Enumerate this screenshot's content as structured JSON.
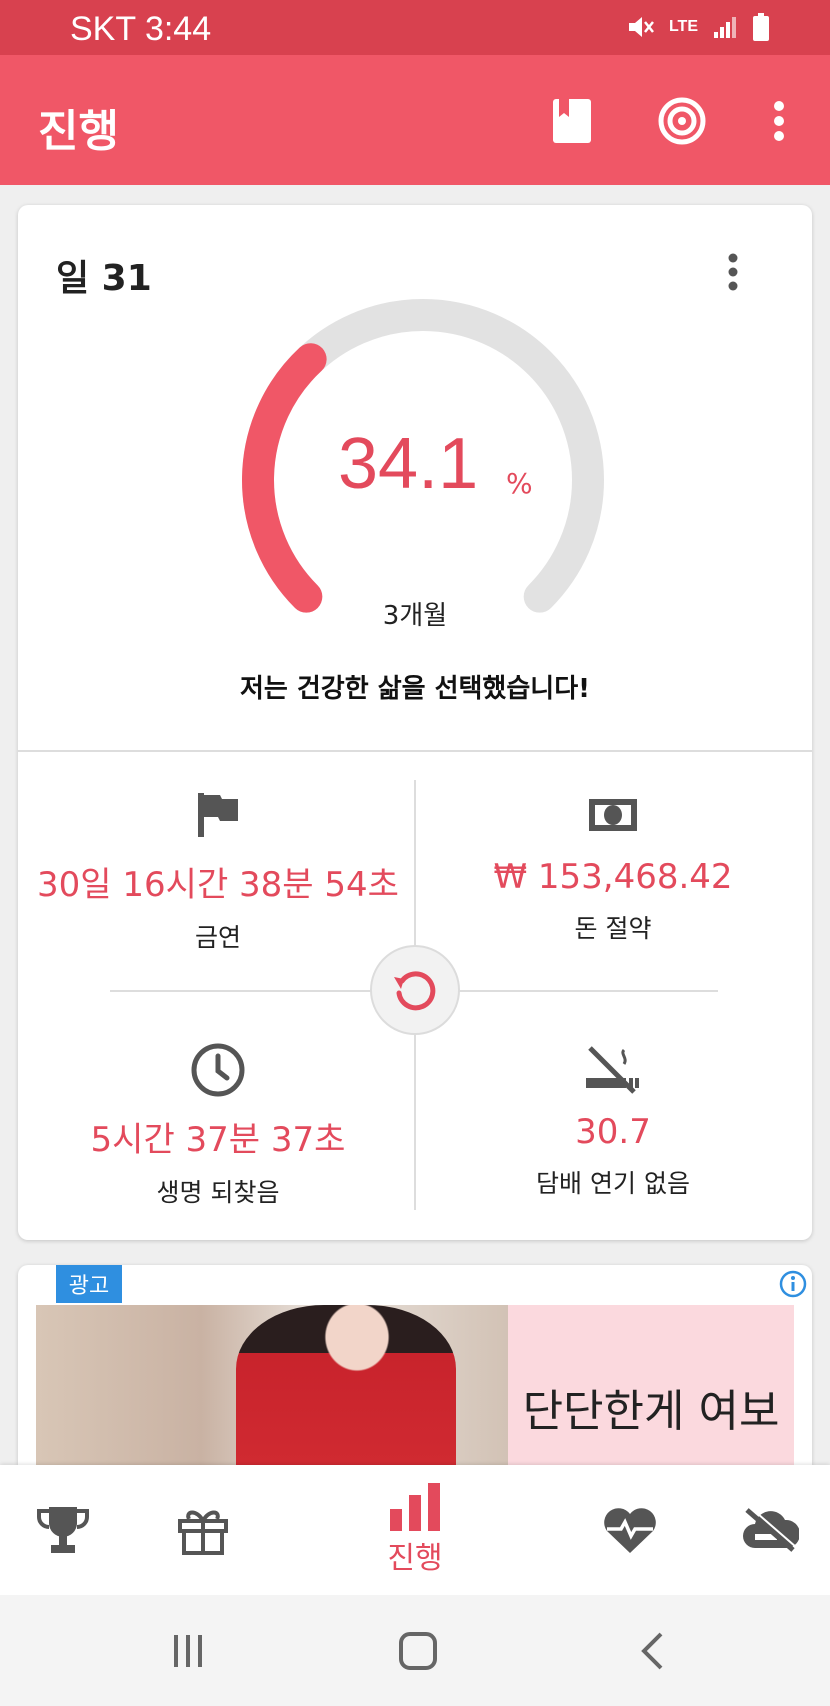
{
  "status_bar": {
    "carrier_time": "SKT 3:44",
    "network": "LTE"
  },
  "app_bar": {
    "title": "진행"
  },
  "progress": {
    "day_label": "일 31",
    "percent_value": "34.1",
    "percent_unit": "%",
    "percent_fraction": 0.341,
    "goal_label": "3개월",
    "motto": "저는 건강한 삶을 선택했습니다!"
  },
  "stats": {
    "quit_time": {
      "value": "30일 16시간 38분 54초",
      "label": "금연"
    },
    "money_saved": {
      "value": "₩ 153,468.42",
      "label": "돈 절약"
    },
    "life_regained": {
      "value": "5시간 37분 37초",
      "label": "생명 되찾음"
    },
    "not_smoked": {
      "value": "30.7",
      "label": "담배 연기 없음"
    }
  },
  "ad": {
    "badge": "광고",
    "text": "단단한게 여보"
  },
  "bottom_nav": {
    "active_label": "진행"
  },
  "colors": {
    "accent": "#f05767",
    "status": "#d8414f",
    "value_red": "#e34a5c"
  }
}
